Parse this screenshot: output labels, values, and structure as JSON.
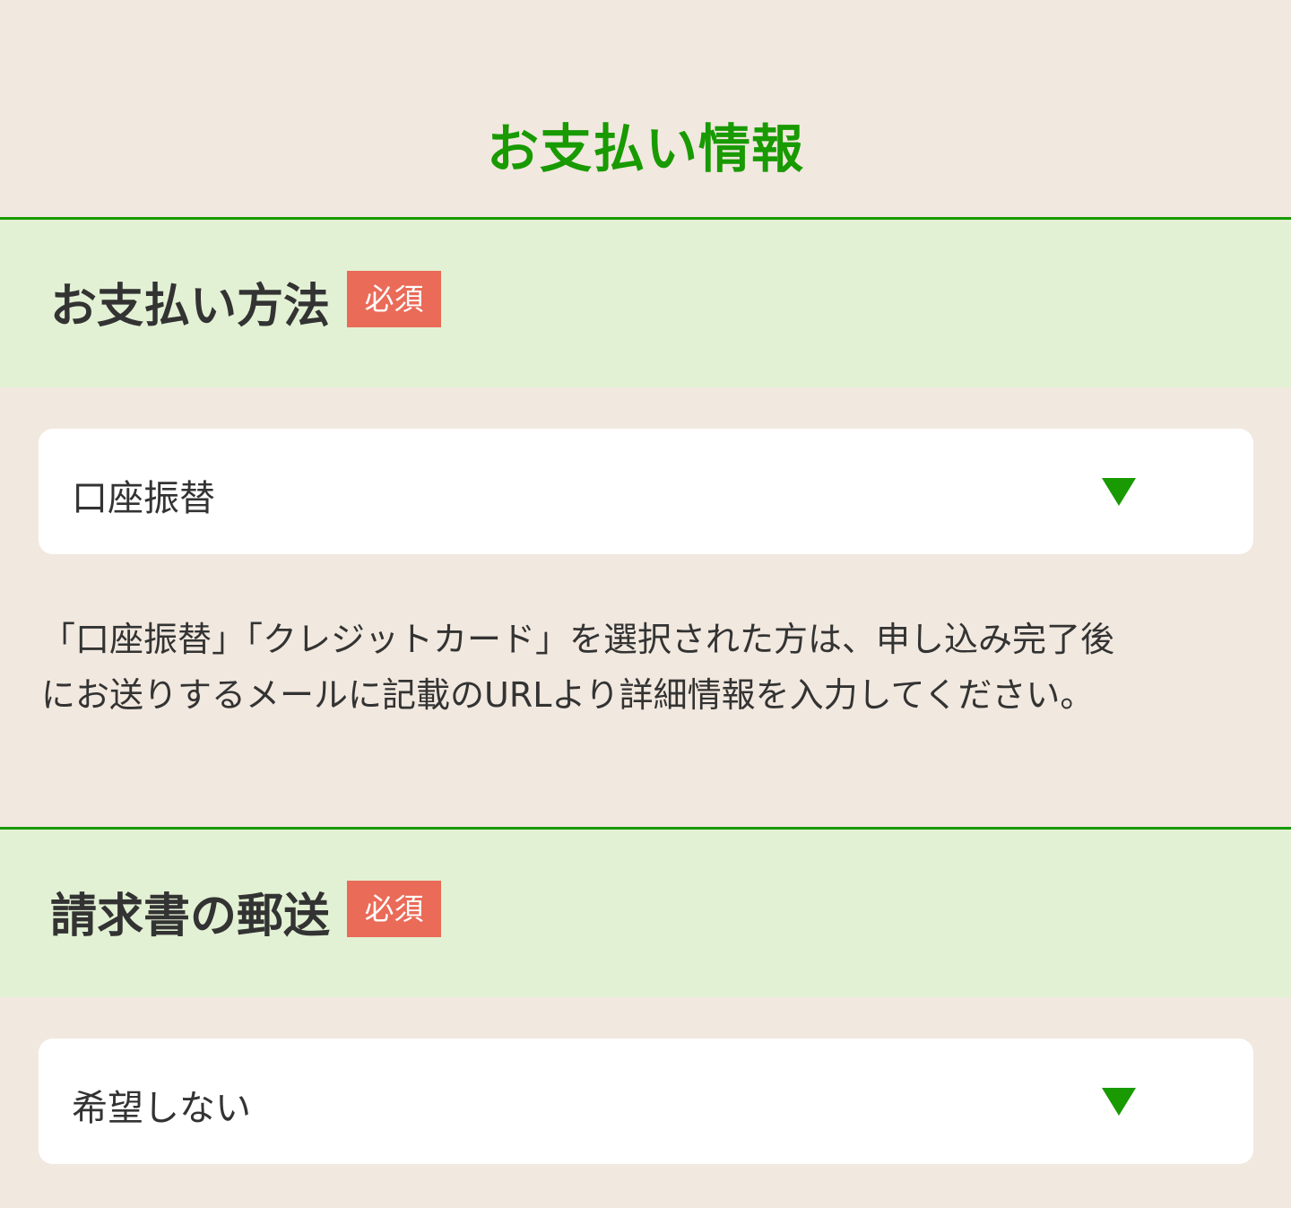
{
  "page": {
    "title": "お支払い情報"
  },
  "payment_method": {
    "label": "お支払い方法",
    "required_badge": "必須",
    "selected_value": "口座振替",
    "note_line1": "「口座振替」「クレジットカード」を選択された方は、申し込み完了後",
    "note_line2": "にお送りするメールに記載のURLより詳細情報を入力してください。"
  },
  "invoice_mailing": {
    "label": "請求書の郵送",
    "required_badge": "必須",
    "selected_value": "希望しない"
  },
  "icons": {
    "dropdown": "caret-down-icon"
  },
  "colors": {
    "accent_green": "#189a00",
    "section_background": "#e2f1d4",
    "page_background": "#f1e8df",
    "required_badge": "#ea6b58"
  }
}
